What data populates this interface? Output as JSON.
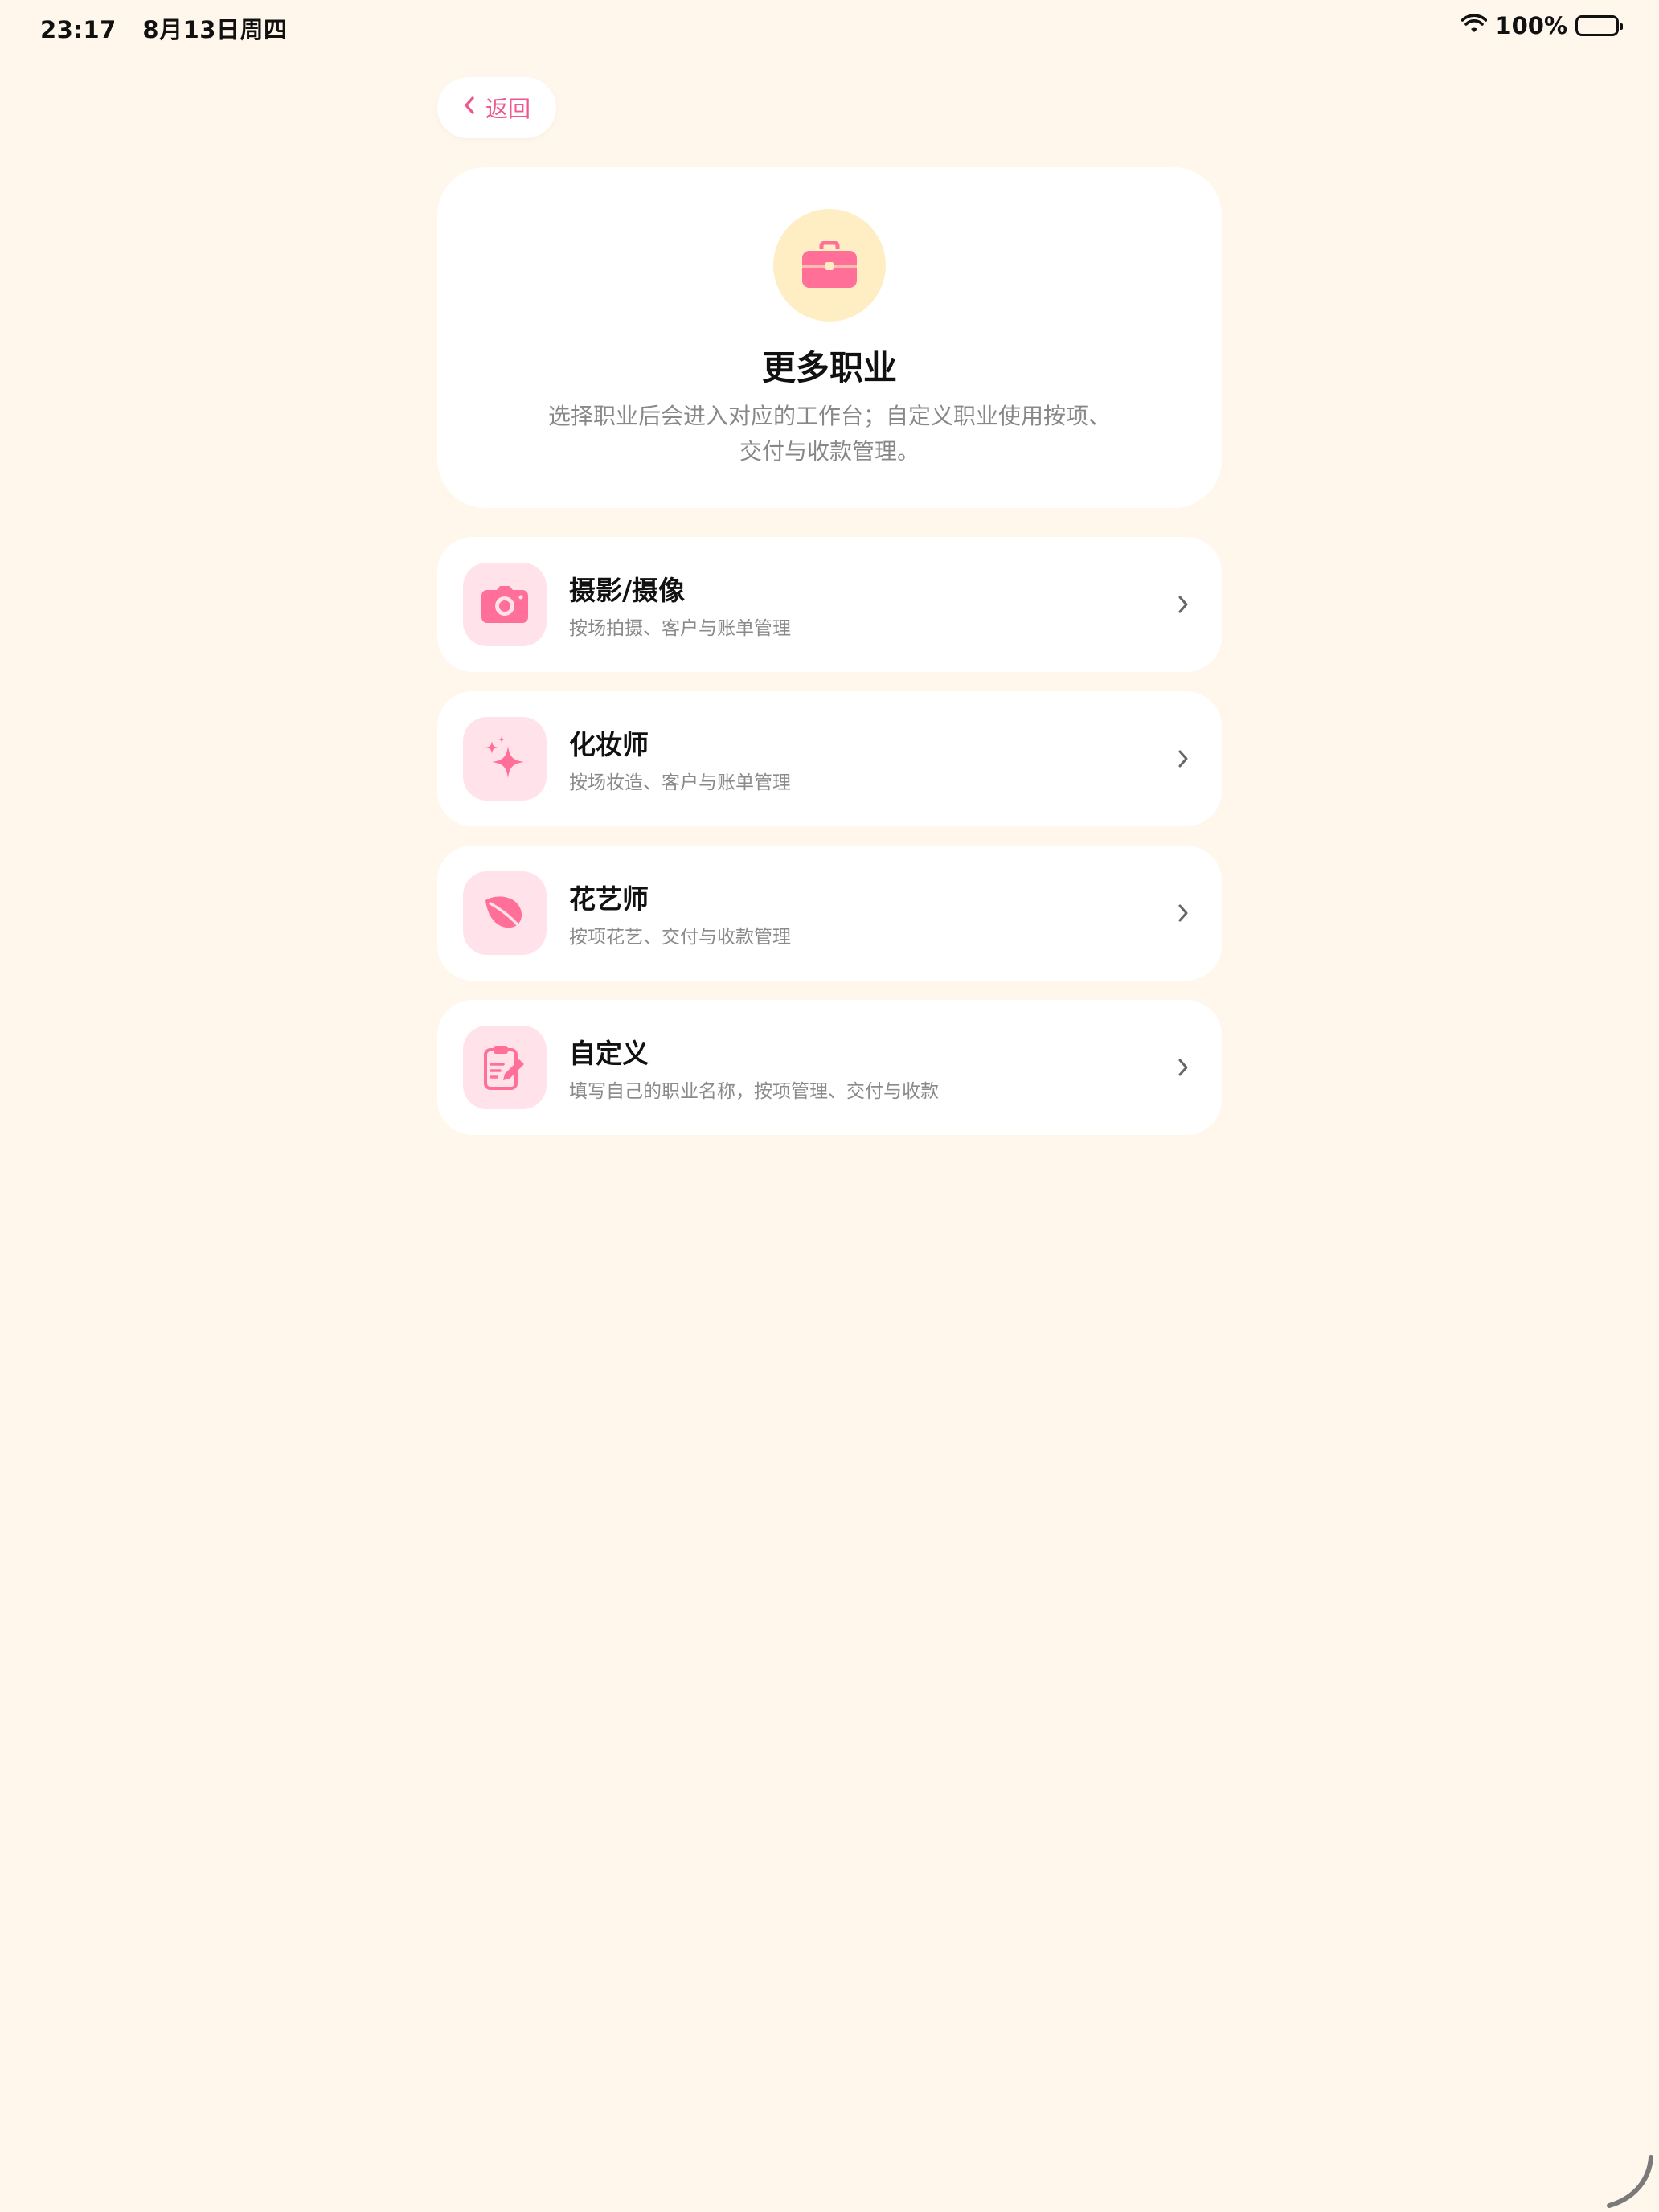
{
  "status_bar": {
    "time": "23:17",
    "date": "8月13日周四",
    "battery": "100%",
    "icons": [
      "wifi-icon",
      "battery-icon"
    ]
  },
  "nav": {
    "back_label": "返回",
    "back_icon": "chevron-left-icon"
  },
  "hero": {
    "icon": "briefcase-icon",
    "title": "更多职业",
    "description": "选择职业后会进入对应的工作台；自定义职业使用按项、交付与收款管理。"
  },
  "jobs": [
    {
      "icon": "camera-icon",
      "title": "摄影/摄像",
      "subtitle": "按场拍摄、客户与账单管理"
    },
    {
      "icon": "sparkle-icon",
      "title": "化妆师",
      "subtitle": "按场妆造、客户与账单管理"
    },
    {
      "icon": "leaf-icon",
      "title": "花艺师",
      "subtitle": "按项花艺、交付与收款管理"
    },
    {
      "icon": "clipboard-edit-icon",
      "title": "自定义",
      "subtitle": "填写自己的职业名称，按项管理、交付与收款"
    }
  ],
  "colors": {
    "background": "#FFF7EC",
    "accent": "#F0578F",
    "icon_pink": "#FF6F98",
    "hero_icon_bg": "#FFEDC4",
    "job_icon_bg": "#FFE2EA"
  }
}
